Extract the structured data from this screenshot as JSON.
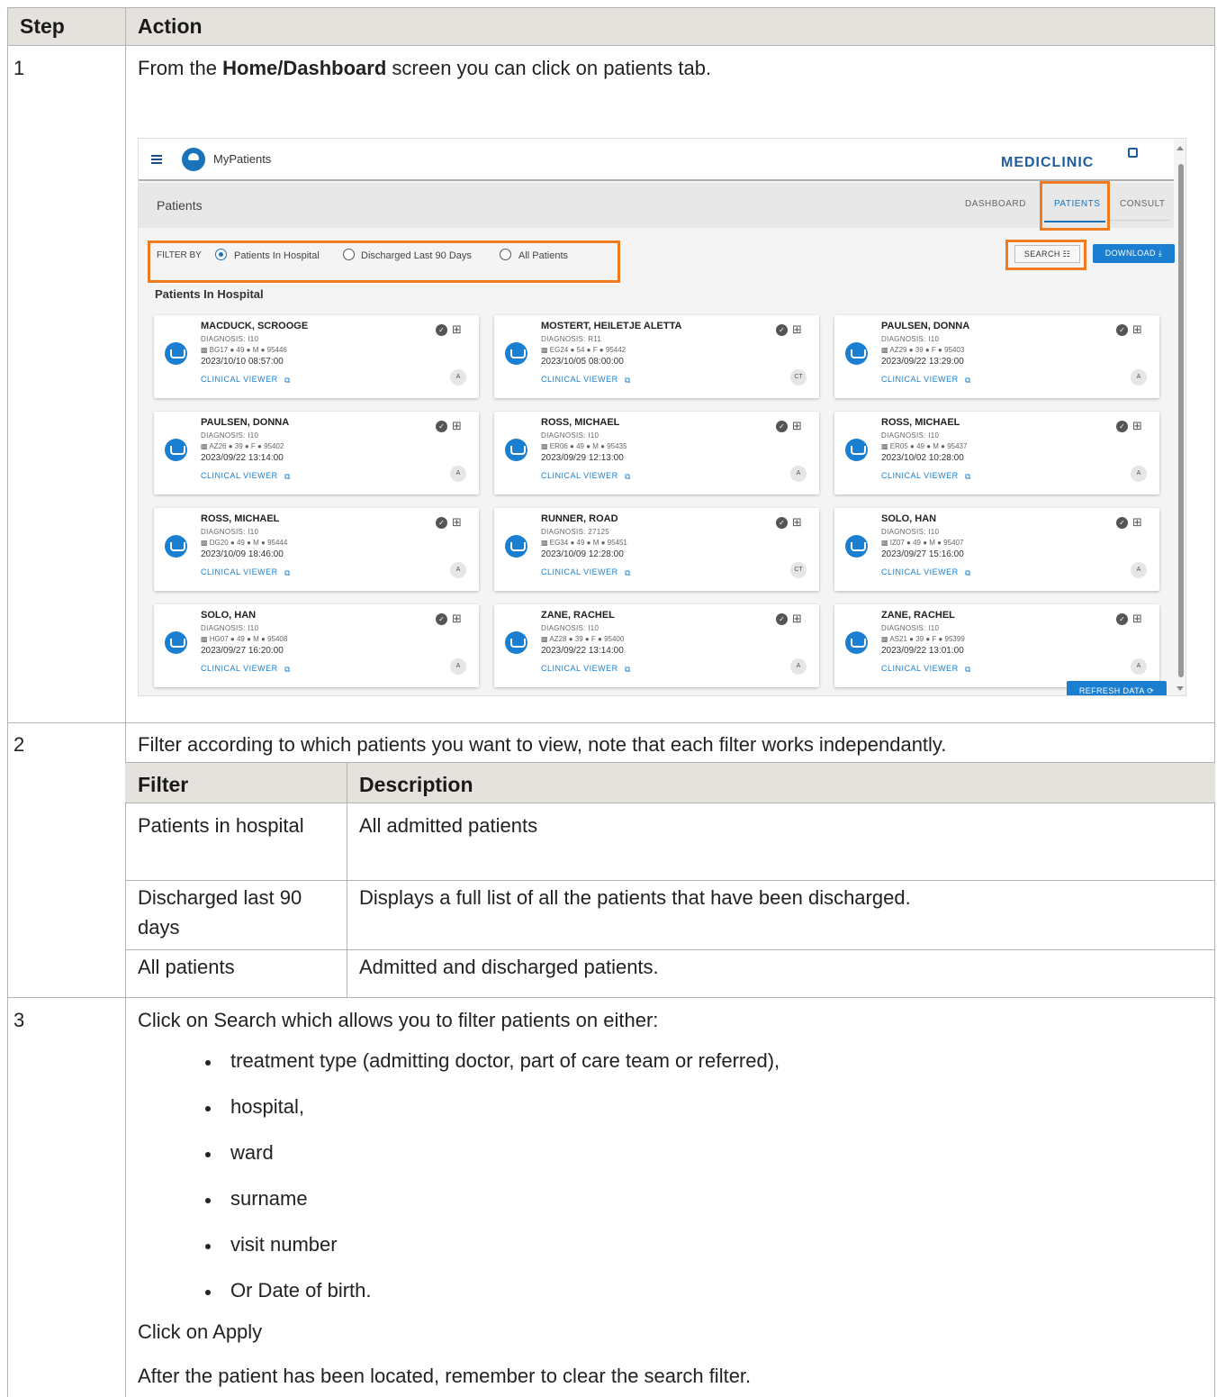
{
  "table": {
    "headers": {
      "step": "Step",
      "action": "Action"
    },
    "rows": [
      {
        "step": "1",
        "intro_prefix": "From the ",
        "intro_bold": "Home/Dashboard",
        "intro_suffix": " screen you can click on patients tab."
      },
      {
        "step": "2",
        "text": "Filter according to which patients you want to view, note that each filter works independantly.",
        "filter_table": {
          "headers": {
            "filter": "Filter",
            "description": "Description"
          },
          "rows": [
            {
              "filter": "Patients in hospital",
              "description": "All admitted patients"
            },
            {
              "filter": "Discharged last 90 days",
              "description": "Displays a full list of all the patients that have been discharged."
            },
            {
              "filter": "All patients",
              "description": "Admitted and discharged patients."
            }
          ]
        }
      },
      {
        "step": "3",
        "text": "Click on Search which allows you to filter patients on either:",
        "bullets": [
          "treatment type (admitting doctor, part of care team or referred),",
          "hospital,",
          "ward",
          "surname",
          "visit number",
          "Or Date of birth."
        ],
        "apply": "Click on Apply",
        "after": "After the patient has been located, remember to clear the search filter."
      }
    ]
  },
  "screenshot": {
    "app_name": "MyPatients",
    "brand": "MEDICLINIC",
    "page_title": "Patients",
    "tabs": [
      "DASHBOARD",
      "PATIENTS",
      "CONSULT"
    ],
    "active_tab": "PATIENTS",
    "filter_label": "FILTER BY",
    "filters": [
      "Patients In Hospital",
      "Discharged Last 90 Days",
      "All Patients"
    ],
    "selected_filter": "Patients In Hospital",
    "search_button": "SEARCH",
    "download_button": "DOWNLOAD",
    "section_title": "Patients In Hospital",
    "refresh_button": "REFRESH DATA",
    "clinical_viewer": "CLINICAL VIEWER",
    "highlight_color": "#f07b22",
    "accent_color": "#1a7fd0",
    "patients": [
      {
        "name": "MACDUCK, SCROOGE",
        "diagnosis": "DIAGNOSIS: I10",
        "info": "BG17 ● 49 ● M ● 95446",
        "datetime": "2023/10/10 08:57:00",
        "badge": "A"
      },
      {
        "name": "MOSTERT, HEILETJE ALETTA",
        "diagnosis": "DIAGNOSIS: R11",
        "info": "EG24 ● 54 ● F ● 95442",
        "datetime": "2023/10/05 08:00:00",
        "badge": "CT"
      },
      {
        "name": "PAULSEN, DONNA",
        "diagnosis": "DIAGNOSIS: I10",
        "info": "AZ29 ● 39 ● F ● 95403",
        "datetime": "2023/09/22 13:29:00",
        "badge": "A"
      },
      {
        "name": "PAULSEN, DONNA",
        "diagnosis": "DIAGNOSIS: I10",
        "info": "AZ26 ● 39 ● F ● 95402",
        "datetime": "2023/09/22 13:14:00",
        "badge": "A"
      },
      {
        "name": "ROSS, MICHAEL",
        "diagnosis": "DIAGNOSIS: I10",
        "info": "ER06 ● 49 ● M ● 95435",
        "datetime": "2023/09/29 12:13:00",
        "badge": "A"
      },
      {
        "name": "ROSS, MICHAEL",
        "diagnosis": "DIAGNOSIS: I10",
        "info": "ER05 ● 49 ● M ● 95437",
        "datetime": "2023/10/02 10:28:00",
        "badge": "A"
      },
      {
        "name": "ROSS, MICHAEL",
        "diagnosis": "DIAGNOSIS: I10",
        "info": "DG20 ● 49 ● M ● 95444",
        "datetime": "2023/10/09 18:46:00",
        "badge": "A"
      },
      {
        "name": "RUNNER, ROAD",
        "diagnosis": "DIAGNOSIS: 27125",
        "info": "EG34 ● 49 ● M ● 95451",
        "datetime": "2023/10/09 12:28:00",
        "badge": "CT"
      },
      {
        "name": "SOLO, HAN",
        "diagnosis": "DIAGNOSIS: I10",
        "info": "IZ07 ● 49 ● M ● 95407",
        "datetime": "2023/09/27 15:16:00",
        "badge": "A"
      },
      {
        "name": "SOLO, HAN",
        "diagnosis": "DIAGNOSIS: I10",
        "info": "HG07 ● 49 ● M ● 95408",
        "datetime": "2023/09/27 16:20:00",
        "badge": "A"
      },
      {
        "name": "ZANE, RACHEL",
        "diagnosis": "DIAGNOSIS: I10",
        "info": "AZ28 ● 39 ● F ● 95400",
        "datetime": "2023/09/22 13:14:00",
        "badge": "A"
      },
      {
        "name": "ZANE, RACHEL",
        "diagnosis": "DIAGNOSIS: I10",
        "info": "AS21 ● 39 ● F ● 95399",
        "datetime": "2023/09/22 13:01:00",
        "badge": "A"
      }
    ]
  }
}
